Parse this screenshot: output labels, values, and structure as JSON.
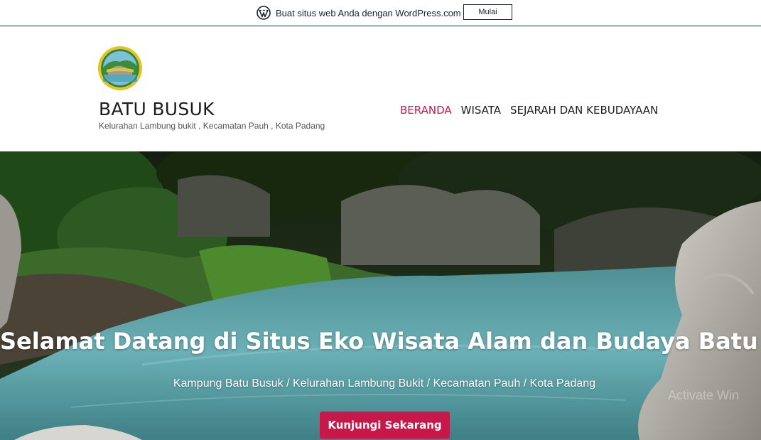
{
  "wpbar": {
    "text": "Buat situs web Anda dengan WordPress.com",
    "button_label": "Mulai",
    "logo_icon": "wordpress-logo-icon"
  },
  "header": {
    "site_title": "BATU BUSUK",
    "site_description": "Kelurahan Lambung bukit , Kecamatan Pauh , Kota Padang",
    "logo": "site-logo",
    "nav": [
      {
        "label": "BERANDA",
        "active": true
      },
      {
        "label": "WISATA",
        "active": false
      },
      {
        "label": "SEJARAH DAN KEBUDAYAAN",
        "active": false
      }
    ]
  },
  "hero": {
    "title": "Selamat Datang di Situs Eko Wisata Alam dan Budaya Batu Busuk",
    "subtitle": "Kampung Batu Busuk / Kelurahan Lambung Bukit / Kecamatan Pauh / Kota Padang",
    "cta_label": "Kunjungi Sekarang",
    "watermark": "Activate Win"
  },
  "colors": {
    "accent": "#c8184a",
    "text_dark": "#1c1c1c",
    "water": "#5fa6ad"
  }
}
